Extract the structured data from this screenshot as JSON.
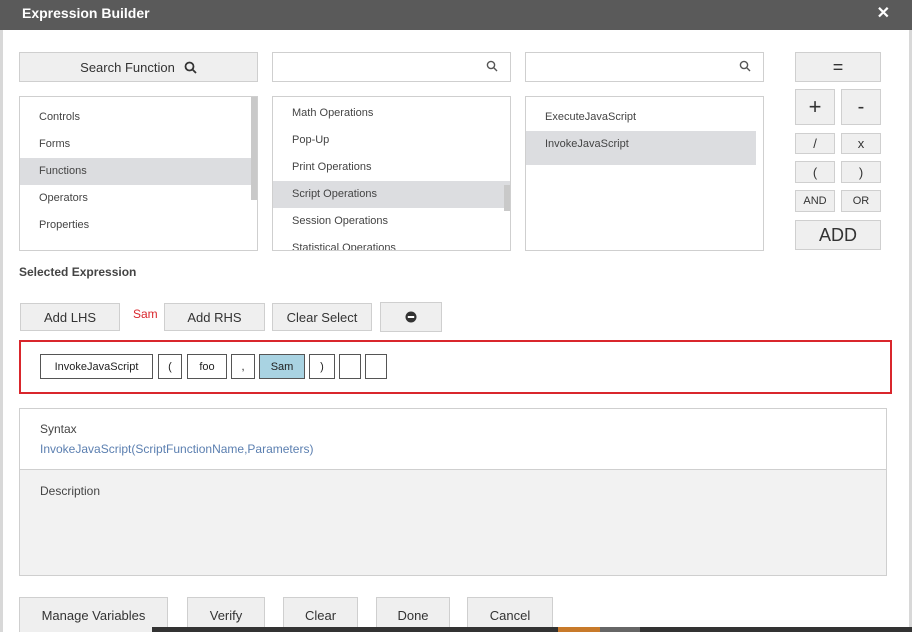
{
  "dialog": {
    "title": "Expression Builder"
  },
  "search": {
    "button_label": "Search Function",
    "box1_value": "",
    "box2_value": ""
  },
  "categories": [
    "Controls",
    "Forms",
    "Functions",
    "Operators",
    "Properties"
  ],
  "categories_selected": 2,
  "subcategories": [
    "Math Operations",
    "Pop-Up",
    "Print Operations",
    "Script Operations",
    "Session Operations",
    "Statistical Operations"
  ],
  "subcategories_selected": 3,
  "functions": [
    "ExecuteJavaScript",
    "InvokeJavaScript"
  ],
  "functions_selected": 1,
  "operators": {
    "equals": "=",
    "plus": "+",
    "minus": "-",
    "divide": "/",
    "multiply": "x",
    "open_paren": "(",
    "close_paren": ")",
    "and": "AND",
    "or": "OR",
    "add": "ADD"
  },
  "selected_expression": {
    "label": "Selected Expression",
    "add_lhs": "Add LHS",
    "lhs_value": "Sam",
    "add_rhs": "Add RHS",
    "clear_select": "Clear Select"
  },
  "expression_tokens": [
    "InvokeJavaScript",
    "(",
    "foo",
    ",",
    "Sam",
    ")",
    "",
    ""
  ],
  "syntax": {
    "label": "Syntax",
    "value": "InvokeJavaScript(ScriptFunctionName,Parameters)",
    "description_label": "Description"
  },
  "footer": {
    "manage_variables": "Manage Variables",
    "verify": "Verify",
    "clear": "Clear",
    "done": "Done",
    "cancel": "Cancel"
  },
  "colors": {
    "titlebar": "#5a5a5a",
    "highlight_token": "#a9d3e2",
    "expression_border": "#d9262c",
    "lhs_value": "#d9262c",
    "syntax_value": "#5b7fb0"
  }
}
